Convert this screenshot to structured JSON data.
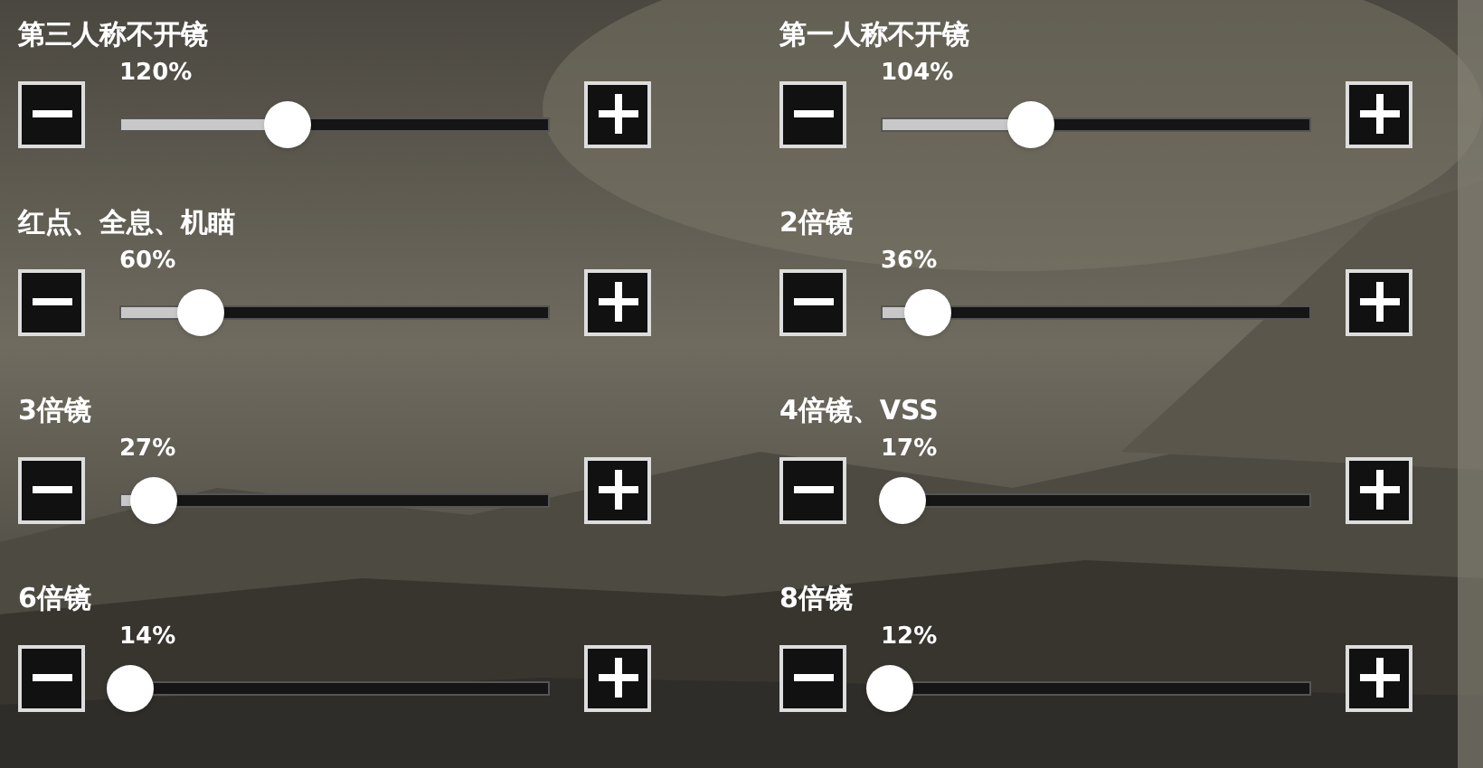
{
  "settings": [
    {
      "label": "第三人称不开镜",
      "reading": "120%",
      "level": 0.39
    },
    {
      "label": "第一人称不开镜",
      "reading": "104%",
      "level": 0.35
    },
    {
      "label": "红点、全息、机瞄",
      "reading": "60%",
      "level": 0.19
    },
    {
      "label": "2倍镜",
      "reading": "36%",
      "level": 0.11
    },
    {
      "label": "3倍镜",
      "reading": "27%",
      "level": 0.08
    },
    {
      "label": "4倍镜、VSS",
      "reading": "17%",
      "level": 0.05
    },
    {
      "label": "6倍镜",
      "reading": "14%",
      "level": 0.025
    },
    {
      "label": "8倍镜",
      "reading": "12%",
      "level": 0.02
    }
  ]
}
